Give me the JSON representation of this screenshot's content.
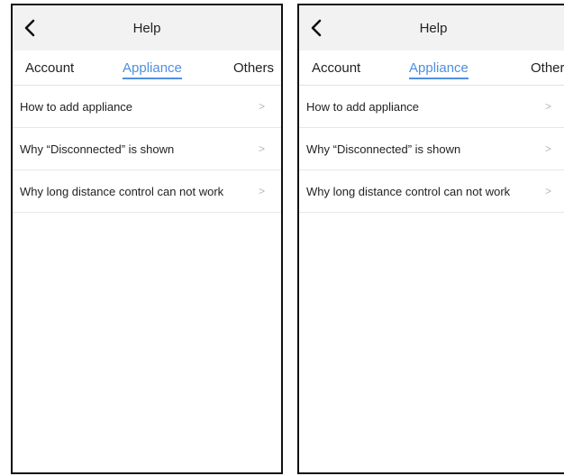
{
  "screens": [
    {
      "header": {
        "title": "Help",
        "back_icon": "chevron-left-icon"
      },
      "tabs": [
        {
          "label": "Account",
          "active": false
        },
        {
          "label": "Appliance",
          "active": true
        },
        {
          "label": "Others",
          "active": false
        }
      ],
      "items": [
        {
          "label": "How to add appliance",
          "chevron": ">"
        },
        {
          "label": "Why “Disconnected” is shown",
          "chevron": ">"
        },
        {
          "label": "Why long distance control can not work",
          "chevron": ">"
        }
      ]
    },
    {
      "header": {
        "title": "Help",
        "back_icon": "chevron-left-icon"
      },
      "tabs": [
        {
          "label": "Account",
          "active": false
        },
        {
          "label": "Appliance",
          "active": true
        },
        {
          "label": "Others",
          "active": false
        }
      ],
      "items": [
        {
          "label": "How to add appliance",
          "chevron": ">"
        },
        {
          "label": "Why “Disconnected” is shown",
          "chevron": ">"
        },
        {
          "label": "Why long distance control can not work",
          "chevron": ">"
        }
      ]
    }
  ],
  "colors": {
    "accent": "#4f8fe0",
    "header_bg": "#f2f2f2",
    "text": "#222222",
    "chevron": "#b8b8b8",
    "divider": "#e7e7e7"
  }
}
